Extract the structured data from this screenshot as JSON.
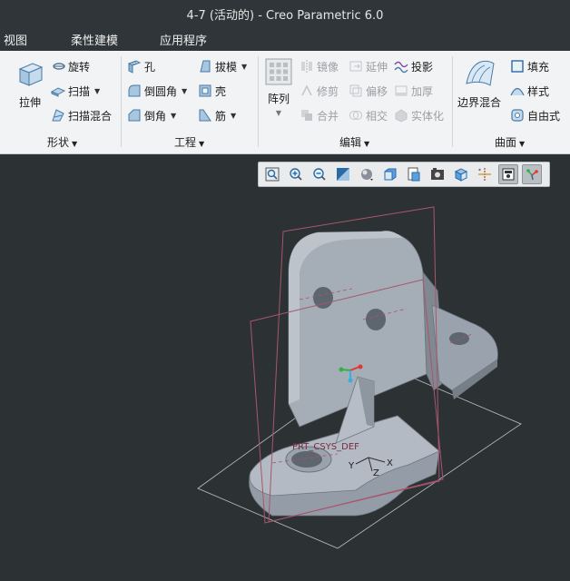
{
  "window": {
    "title": "4-7 (活动的) - Creo Parametric 6.0"
  },
  "menubar": {
    "items": [
      "视图",
      "柔性建模",
      "应用程序"
    ]
  },
  "ribbon": {
    "shape": {
      "label": "形状",
      "extrude": "拉伸",
      "revolve": "旋转",
      "sweep": "扫描",
      "swept_blend": "扫描混合"
    },
    "engineering": {
      "label": "工程",
      "hole": "孔",
      "round": "倒圆角",
      "chamfer": "倒角",
      "draft": "拔模",
      "shell": "壳",
      "rib": "筋"
    },
    "editing": {
      "label": "编辑",
      "pattern": "阵列",
      "mirror": "镜像",
      "trim": "修剪",
      "merge": "合并",
      "extend": "延伸",
      "offset": "偏移",
      "intersect": "相交",
      "project": "投影",
      "thicken": "加厚",
      "solidify": "实体化"
    },
    "surfaces": {
      "label": "曲面",
      "boundary_blend": "边界混合",
      "fill": "填充",
      "style": "样式",
      "freestyle": "自由式"
    }
  },
  "viewport": {
    "csys_label": "PRT_CSYS_DEF",
    "axis_x": "X",
    "axis_y": "Y",
    "axis_z": "Z"
  },
  "view_toolbar": {
    "icons": [
      "refit-icon",
      "zoom-in-icon",
      "zoom-out-icon",
      "repaint-icon",
      "display-style-icon",
      "saved-orientations-icon",
      "view-manager-icon",
      "perspective-view-icon",
      "section-icon",
      "datum-display-icon",
      "spin-center-icon",
      "annotation-display-icon"
    ]
  },
  "colors": {
    "title_bg": "#2f3538",
    "ribbon_bg": "#f2f3f4",
    "viewport_bg": "#2c3134",
    "model": "#9aa3ae",
    "datum_plane": "#b0526a"
  }
}
